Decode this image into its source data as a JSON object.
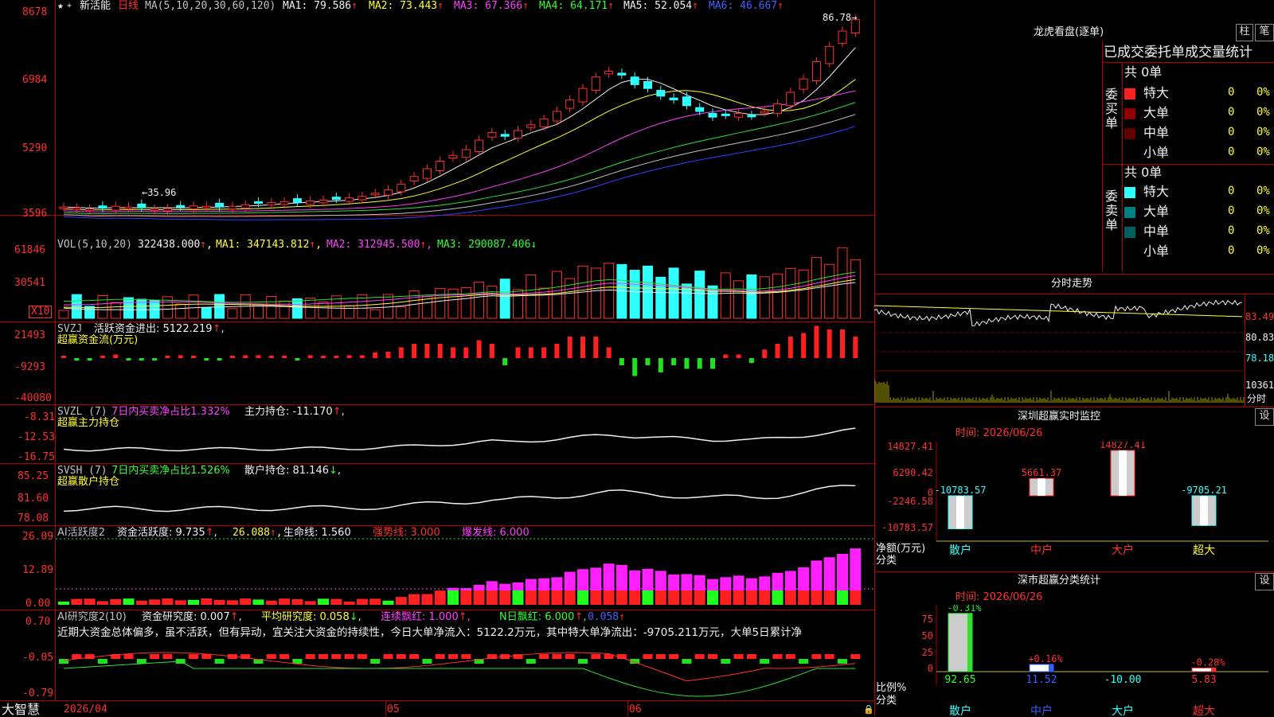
{
  "colors": {
    "up": "#ff3030",
    "down": "#30ffff",
    "ma1": "#f0f0f0",
    "ma2": "#ffff30",
    "ma3": "#ff40ff",
    "ma4": "#30e030",
    "ma5": "#c0c0c0",
    "ma6": "#3040ff"
  },
  "app": {
    "logo": "大智慧",
    "window_icon": "lock-icon"
  },
  "main": {
    "stock_name": "新活能",
    "period": "日线",
    "ma_label": "MA(5,10,20,30,60,120)",
    "ma1": "MA1: 79.586",
    "ma2": "MA2: 73.443",
    "ma3": "MA3: 67.366",
    "ma4": "MA4: 64.171",
    "ma5": "MA5: 52.054",
    "ma6": "MA6: 46.667",
    "y_ticks": [
      "8678",
      "6984",
      "5290",
      "3596"
    ],
    "high_label": "86.78",
    "low_label": "35.96"
  },
  "vol": {
    "label": "VOL(5,10,20)",
    "value": "322438.000",
    "ma1": "MA1: 347143.812",
    "ma2": "MA2: 312945.500",
    "ma3": "MA3: 290087.406",
    "y_ticks": [
      "61846",
      "30541"
    ],
    "mult": "X10"
  },
  "svzj": {
    "label": "SVZJ",
    "desc": "活跃资金进出: 5122.219",
    "title": "超赢资金流(万元)",
    "y_ticks": [
      "21493",
      "-9293",
      "-40080"
    ]
  },
  "svzl": {
    "label": "SVZL (7)",
    "ratio": "7日内买卖净占比1.332%",
    "hold": "主力持仓: -11.170",
    "title": "超赢主力持仓",
    "y_ticks": [
      "-8.31",
      "-12.53",
      "-16.75"
    ]
  },
  "svsh": {
    "label": "SVSH (7)",
    "ratio": "7日内买卖净占比1.526%",
    "hold": "散户持仓: 81.146",
    "title": "超赢散户持仓",
    "y_ticks": [
      "85.25",
      "81.60",
      "78.08"
    ]
  },
  "ai1": {
    "label": "AI活跃度2",
    "active": "资金活跃度: 9.735",
    "v2": "26.088",
    "life": "生命线: 1.560",
    "strong": "强势线: 3.000",
    "burst": "爆发线: 6.000",
    "y_ticks": [
      "26.09",
      "12.89",
      "0.00"
    ]
  },
  "ai2": {
    "label": "AI研究度2(10)",
    "research": "资金研究度: 0.007",
    "avg": "平均研究度: 0.058",
    "lian": "连续飘红: 1.000",
    "nday": "N日飘红: 6.000",
    "last": "0.058",
    "comment": "近期大资金总体偏多，虽不活跃，但有异动，宜关注大资金的持续性，今日大单净流入：5122.2万元，其中特大单净流出：-9705.211万元，大单5日累计净",
    "y_ticks": [
      "0.70",
      "-0.05",
      "-0.79"
    ]
  },
  "xaxis": {
    "labels": [
      "2026/04",
      "05",
      "06"
    ]
  },
  "lhb": {
    "title": "龙虎看盘(逐单)",
    "tab1": "柱",
    "tab2": "笔",
    "tabs_row": "已成交委托单成交量统计",
    "buy": {
      "side": "委买单",
      "total": "共 0单",
      "rows": [
        {
          "name": "特大",
          "val": "0",
          "pct": "0%"
        },
        {
          "name": "大单",
          "val": "0",
          "pct": "0%"
        },
        {
          "name": "中单",
          "val": "0",
          "pct": "0%"
        },
        {
          "name": "小单",
          "val": "0",
          "pct": "0%"
        }
      ]
    },
    "sell": {
      "side": "委卖单",
      "total": "共 0单",
      "rows": [
        {
          "name": "特大",
          "val": "0",
          "pct": "0%"
        },
        {
          "name": "大单",
          "val": "0",
          "pct": "0%"
        },
        {
          "name": "中单",
          "val": "0",
          "pct": "0%"
        },
        {
          "name": "小单",
          "val": "0",
          "pct": "0%"
        }
      ]
    }
  },
  "fenshi": {
    "title": "分时走势",
    "y_ticks": [
      "83.49",
      "80.83",
      "78.18"
    ],
    "vol_tick": "10361",
    "vol_label": "分时"
  },
  "monitor": {
    "title": "深圳超赢实时监控",
    "set": "设",
    "time": "时间: 2026/06/26",
    "y_ticks": [
      "14827.41",
      "6290.42",
      "0",
      "-2246.58",
      "-10783.57"
    ],
    "y_unit": "净额(万元)",
    "x_unit": "分类",
    "bars": [
      {
        "cat": "散户",
        "value": "-10783.57",
        "v": -10783.57
      },
      {
        "cat": "中户",
        "value": "5661.37",
        "v": 5661.37
      },
      {
        "cat": "大户",
        "value": "14827.41",
        "v": 14827.41
      },
      {
        "cat": "超大",
        "value": "-9705.21",
        "v": -9705.21
      }
    ]
  },
  "stats": {
    "title": "深市超赢分类统计",
    "set": "设",
    "time": "时间: 2026/06/26",
    "y_ticks": [
      "75",
      "50",
      "25",
      "0"
    ],
    "y_unit": "比例%",
    "x_unit": "分类",
    "bars": [
      {
        "cat": "散户",
        "top": "-0.31%",
        "bottom": "92.65",
        "v": 92.65
      },
      {
        "cat": "中户",
        "top": "+0.16%",
        "bottom": "11.52",
        "v": 11.52
      },
      {
        "cat": "大户",
        "top": "",
        "bottom": "-10.00",
        "v": -10.0
      },
      {
        "cat": "超大",
        "top": "-0.28%",
        "bottom": "5.83",
        "v": 5.83
      }
    ]
  }
}
